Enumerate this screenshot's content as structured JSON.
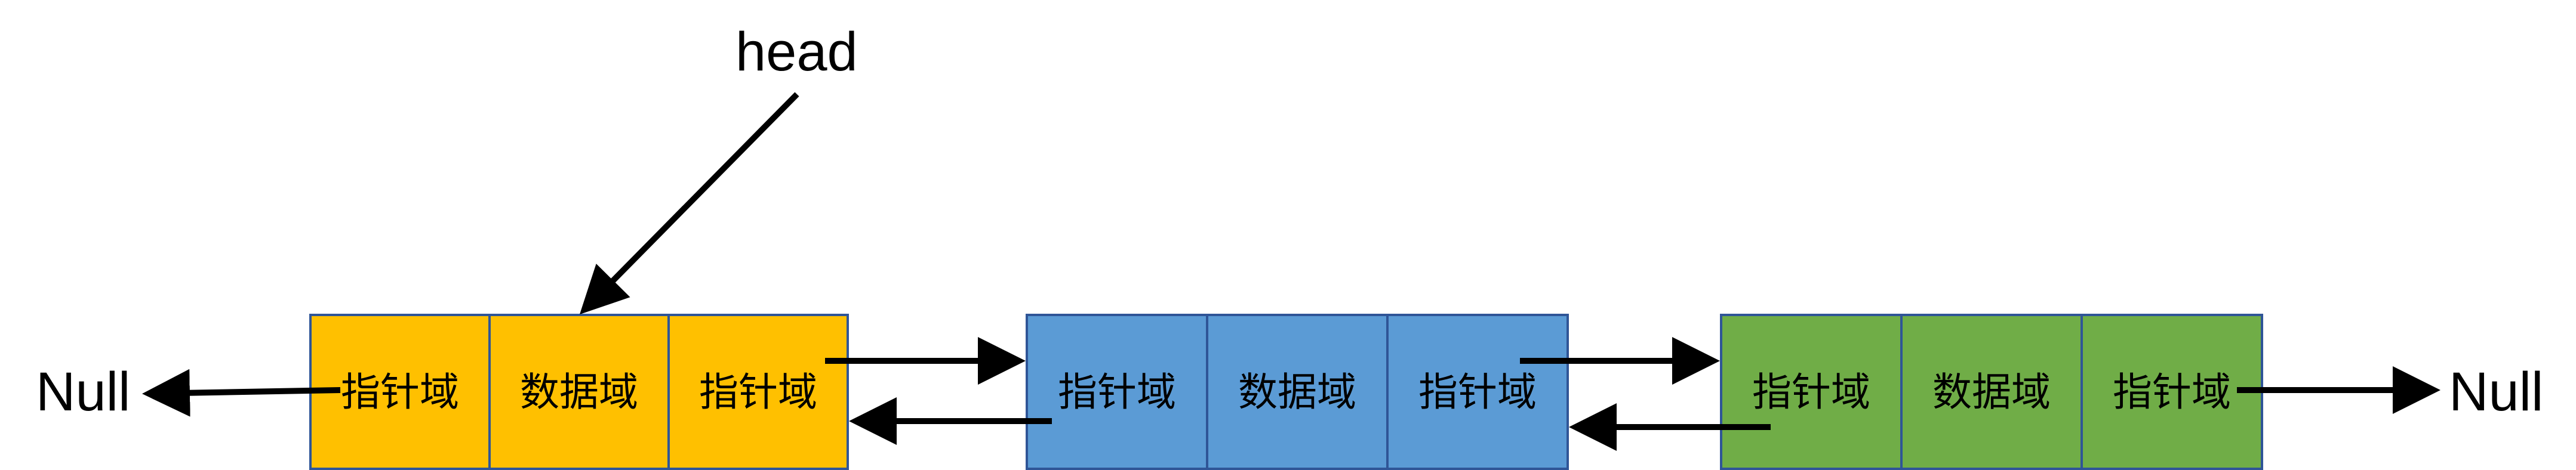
{
  "diagram": {
    "head_label": "head",
    "null_left": "Null",
    "null_right": "Null",
    "nodes": [
      {
        "color": "#FFC000",
        "cells": [
          "指针域",
          "数据域",
          "指针域"
        ]
      },
      {
        "color": "#5B9BD5",
        "cells": [
          "指针域",
          "数据域",
          "指针域"
        ]
      },
      {
        "color": "#70AD47",
        "cells": [
          "指针域",
          "数据域",
          "指针域"
        ]
      }
    ],
    "border_color": "#2F5597",
    "arrow_color": "#000000"
  }
}
